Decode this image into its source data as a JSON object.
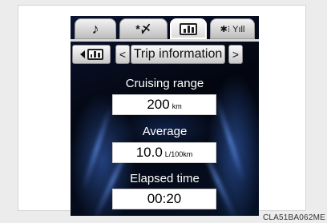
{
  "tabs": [
    {
      "name": "music",
      "icon": "music-note-icon",
      "label": "♪"
    },
    {
      "name": "voice",
      "icon": "voice-recognition-icon",
      "label": "*〆"
    },
    {
      "name": "info",
      "icon": "bar-chart-icon",
      "active": true
    },
    {
      "name": "phone",
      "icon": "bluetooth-signal-icon",
      "label": "✱⁝ Yıll"
    }
  ],
  "header": {
    "prev_category_arrow": "◄",
    "prev_arrow": "<",
    "title": "Trip information",
    "next_arrow": ">"
  },
  "fields": {
    "cruising_range": {
      "label": "Cruising range",
      "value": "200",
      "unit": "km"
    },
    "average": {
      "label": "Average",
      "value": "10.0",
      "unit": "L/100km"
    },
    "elapsed_time": {
      "label": "Elapsed time",
      "value": "00:20"
    }
  },
  "caption": "CLA51BA062ME",
  "colors": {
    "screen_bg": "#03060f",
    "text": "#ffffff",
    "button": "#d9d9d9"
  }
}
